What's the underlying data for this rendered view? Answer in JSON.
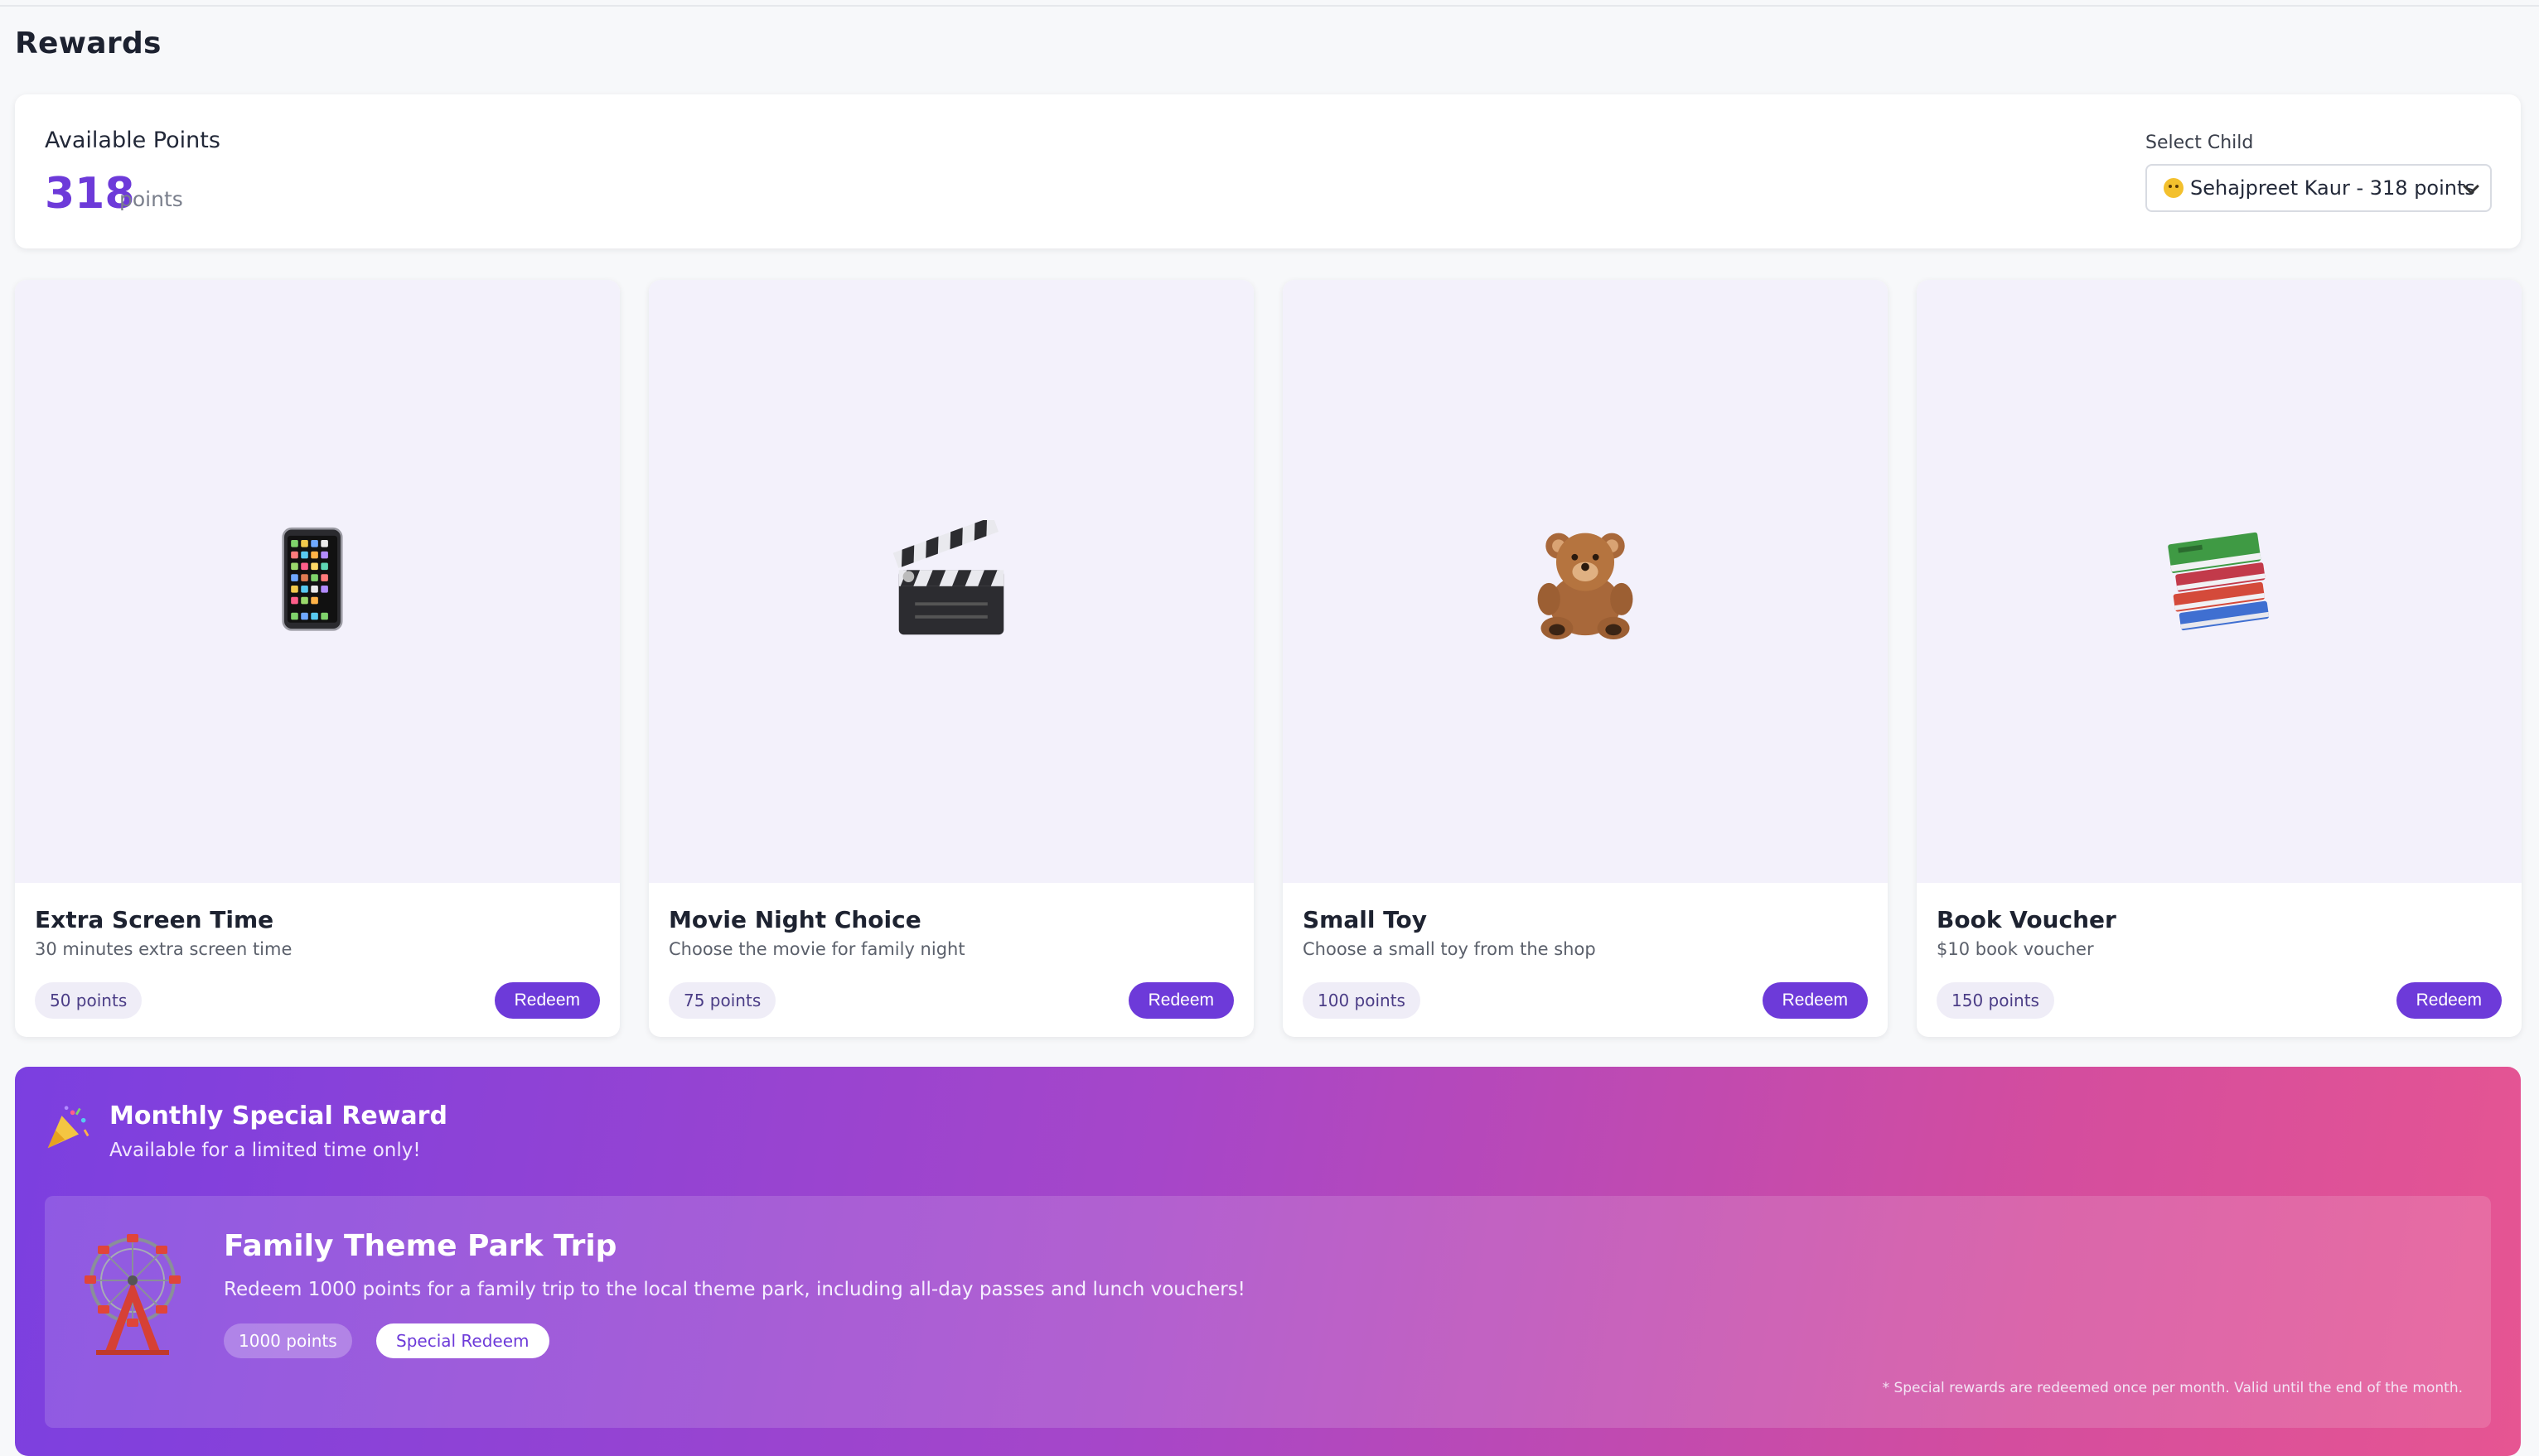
{
  "page": {
    "title": "Rewards"
  },
  "points_card": {
    "label": "Available Points",
    "value": "318",
    "unit": "points",
    "select_label": "Select Child",
    "selected_child": "Sehajpreet Kaur - 318 points"
  },
  "rewards": [
    {
      "title": "Extra Screen Time",
      "description": "30 minutes extra screen time",
      "points": "50 points",
      "button": "Redeem",
      "icon": "mobile-phone-icon"
    },
    {
      "title": "Movie Night Choice",
      "description": "Choose the movie for family night",
      "points": "75 points",
      "button": "Redeem",
      "icon": "clapper-board-icon"
    },
    {
      "title": "Small Toy",
      "description": "Choose a small toy from the shop",
      "points": "100 points",
      "button": "Redeem",
      "icon": "teddy-bear-icon"
    },
    {
      "title": "Book Voucher",
      "description": "$10 book voucher",
      "points": "150 points",
      "button": "Redeem",
      "icon": "books-icon"
    }
  ],
  "special": {
    "title": "Monthly Special Reward",
    "subtitle": "Available for a limited time only!",
    "reward_title": "Family Theme Park Trip",
    "reward_description": "Redeem 1000 points for a family trip to the local theme park, including all-day passes and lunch vouchers!",
    "points": "1000 points",
    "button": "Special Redeem",
    "note": "* Special rewards are redeemed once per month. Valid until the end of the month.",
    "icons": [
      "party-popper-icon",
      "ferris-wheel-icon"
    ]
  },
  "colors": {
    "accent": "#6d3ad9",
    "gradient_start": "#7b3fe0",
    "gradient_end": "#e65592",
    "card_image_bg": "#f3f1fb"
  }
}
